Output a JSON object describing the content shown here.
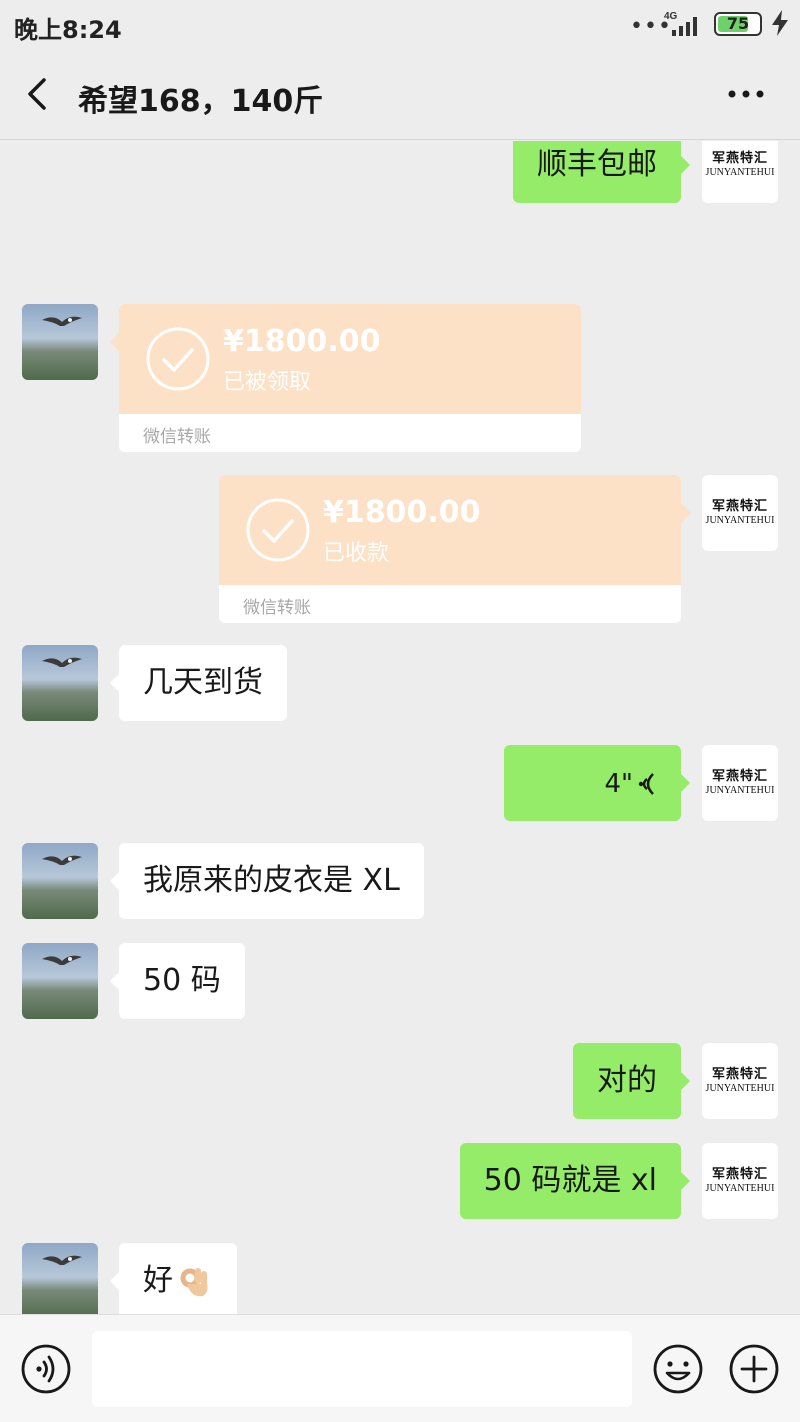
{
  "status_bar": {
    "time": "晚上8:24",
    "network": "4G",
    "battery": "75",
    "battery_fraction": 0.75
  },
  "header": {
    "title": "希望168，140斤"
  },
  "contact_avatar_logo": {
    "cn": "军燕特汇",
    "en": "JUNYANTEHUI"
  },
  "messages": [
    {
      "from": "me",
      "type": "text",
      "text": "顺丰包邮"
    },
    {
      "from": "other",
      "type": "transfer",
      "amount": "¥1800.00",
      "status": "已被领取",
      "label": "微信转账"
    },
    {
      "from": "me",
      "type": "transfer",
      "amount": "¥1800.00",
      "status": "已收款",
      "label": "微信转账"
    },
    {
      "from": "other",
      "type": "text",
      "text": "几天到货"
    },
    {
      "from": "me",
      "type": "voice",
      "duration": "4\""
    },
    {
      "from": "other",
      "type": "text",
      "text": "我原来的皮衣是 XL"
    },
    {
      "from": "other",
      "type": "text",
      "text": "50 码"
    },
    {
      "from": "me",
      "type": "text",
      "text": "对的"
    },
    {
      "from": "me",
      "type": "text",
      "text": "50 码就是 xl"
    },
    {
      "from": "other",
      "type": "text",
      "text": "好",
      "emoji": "ok-hand-emoji"
    }
  ],
  "input_bar": {
    "placeholder": "",
    "icons": [
      "voice-icon",
      "emoji-icon",
      "plus-icon"
    ]
  },
  "colors": {
    "background": "#ededed",
    "my_bubble": "#95ec69",
    "other_bubble": "#ffffff",
    "transfer": "#fce1c6"
  }
}
